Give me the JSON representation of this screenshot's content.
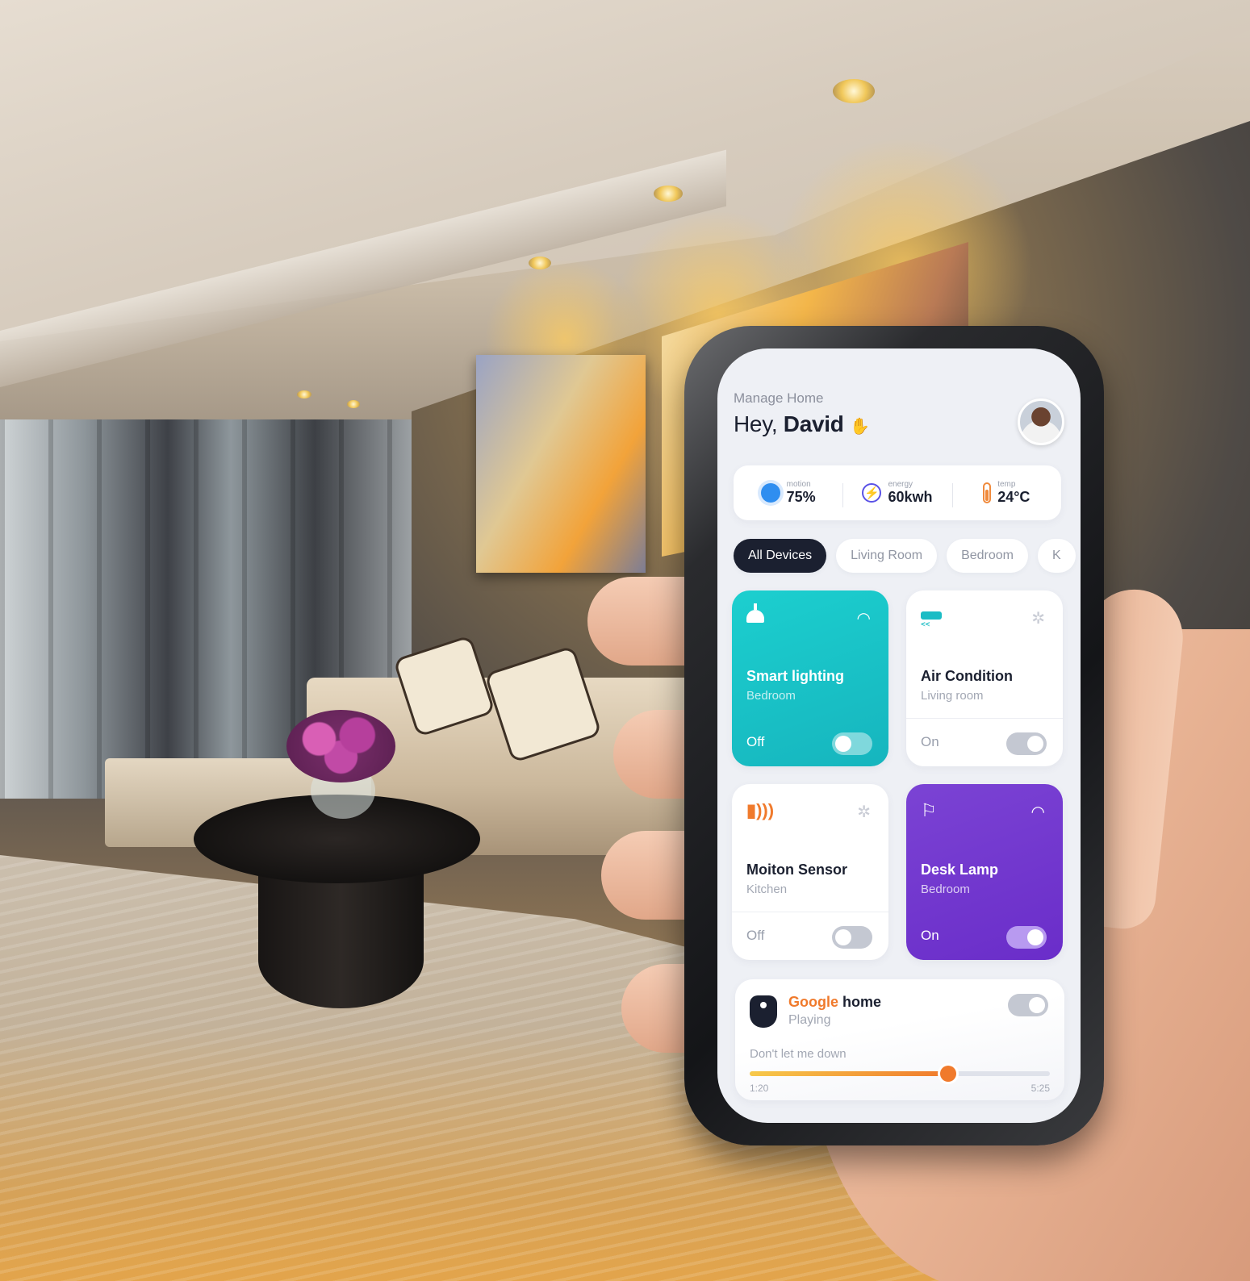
{
  "header": {
    "subtitle": "Manage Home",
    "greeting": "Hey, ",
    "user_name": "David"
  },
  "stats": [
    {
      "label": "motion",
      "value": "75%",
      "icon": "sun-icon"
    },
    {
      "label": "energy",
      "value": "60kwh",
      "icon": "energy-icon"
    },
    {
      "label": "temp",
      "value": "24°C",
      "icon": "thermometer-icon"
    }
  ],
  "tabs": [
    {
      "label": "All Devices",
      "active": true
    },
    {
      "label": "Living Room",
      "active": false
    },
    {
      "label": "Bedroom",
      "active": false
    },
    {
      "label": "K",
      "active": false
    }
  ],
  "devices": [
    {
      "name": "Smart lighting",
      "room": "Bedroom",
      "state": "Off",
      "connection": "wifi",
      "color": "#16b5be",
      "on": false
    },
    {
      "name": "Air Condition",
      "room": "Living room",
      "state": "On",
      "connection": "bluetooth",
      "color": "#ffffff",
      "on": true
    },
    {
      "name": "Moiton Sensor",
      "room": "Kitchen",
      "state": "Off",
      "connection": "bluetooth",
      "color": "#ffffff",
      "on": false
    },
    {
      "name": "Desk Lamp",
      "room": "Bedroom",
      "state": "On",
      "connection": "wifi",
      "color": "#6a2dc9",
      "on": true
    }
  ],
  "player": {
    "brand": "Google",
    "title_rest": " home",
    "status": "Playing",
    "song": "Don't let me down",
    "time_current": "1:20",
    "time_total": "5:25",
    "progress": 0.66,
    "on": true
  },
  "colors": {
    "accent_orange": "#f07a2c",
    "dark": "#1b2030",
    "teal": "#16b5be",
    "purple": "#6a2dc9"
  }
}
